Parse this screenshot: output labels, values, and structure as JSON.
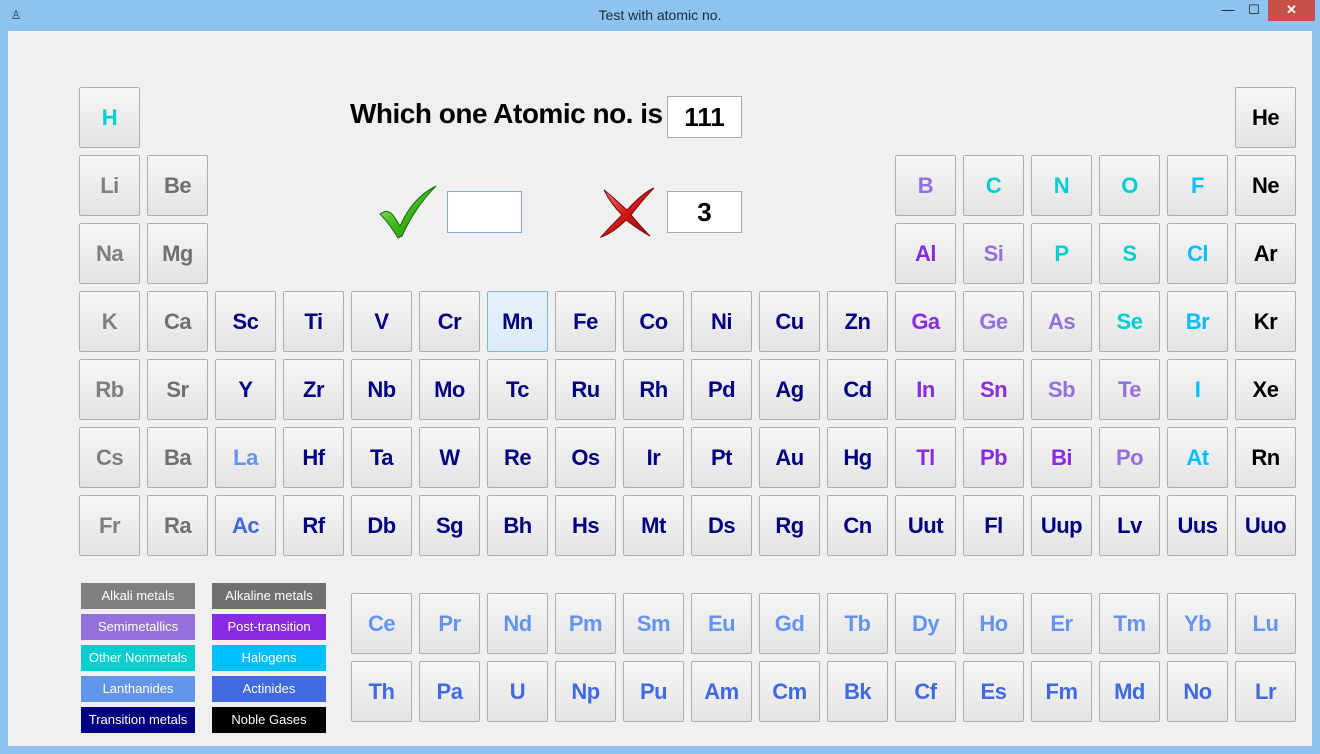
{
  "window": {
    "title": "Test with atomic no.",
    "minimize": "—",
    "maximize": "☐",
    "close": "✕"
  },
  "question": {
    "label": "Which one Atomic no. is :",
    "atomic_number": "111",
    "answer_value": "",
    "wrong_count": "3"
  },
  "colors": {
    "alkali": "#7f7f7f",
    "alkaline": "#707070",
    "semimetal": "#9370db",
    "post": "#8a2be2",
    "nonmetal": "#00ced1",
    "halogen": "#00bfff",
    "lanth": "#6495ed",
    "actin": "#4169e1",
    "trans": "#000080",
    "noble": "#000000",
    "hydrogen": "#00ced1"
  },
  "elements": [
    {
      "symbol": "H",
      "row": 0,
      "col": 0,
      "cat": "hydrogen"
    },
    {
      "symbol": "He",
      "row": 0,
      "col": 17,
      "cat": "noble"
    },
    {
      "symbol": "Li",
      "row": 1,
      "col": 0,
      "cat": "alkali"
    },
    {
      "symbol": "Be",
      "row": 1,
      "col": 1,
      "cat": "alkaline"
    },
    {
      "symbol": "B",
      "row": 1,
      "col": 12,
      "cat": "semimetal"
    },
    {
      "symbol": "C",
      "row": 1,
      "col": 13,
      "cat": "nonmetal"
    },
    {
      "symbol": "N",
      "row": 1,
      "col": 14,
      "cat": "nonmetal"
    },
    {
      "symbol": "O",
      "row": 1,
      "col": 15,
      "cat": "nonmetal"
    },
    {
      "symbol": "F",
      "row": 1,
      "col": 16,
      "cat": "halogen"
    },
    {
      "symbol": "Ne",
      "row": 1,
      "col": 17,
      "cat": "noble"
    },
    {
      "symbol": "Na",
      "row": 2,
      "col": 0,
      "cat": "alkali"
    },
    {
      "symbol": "Mg",
      "row": 2,
      "col": 1,
      "cat": "alkaline"
    },
    {
      "symbol": "Al",
      "row": 2,
      "col": 12,
      "cat": "post"
    },
    {
      "symbol": "Si",
      "row": 2,
      "col": 13,
      "cat": "semimetal"
    },
    {
      "symbol": "P",
      "row": 2,
      "col": 14,
      "cat": "nonmetal"
    },
    {
      "symbol": "S",
      "row": 2,
      "col": 15,
      "cat": "nonmetal"
    },
    {
      "symbol": "Cl",
      "row": 2,
      "col": 16,
      "cat": "halogen"
    },
    {
      "symbol": "Ar",
      "row": 2,
      "col": 17,
      "cat": "noble"
    },
    {
      "symbol": "K",
      "row": 3,
      "col": 0,
      "cat": "alkali"
    },
    {
      "symbol": "Ca",
      "row": 3,
      "col": 1,
      "cat": "alkaline"
    },
    {
      "symbol": "Sc",
      "row": 3,
      "col": 2,
      "cat": "trans"
    },
    {
      "symbol": "Ti",
      "row": 3,
      "col": 3,
      "cat": "trans"
    },
    {
      "symbol": "V",
      "row": 3,
      "col": 4,
      "cat": "trans"
    },
    {
      "symbol": "Cr",
      "row": 3,
      "col": 5,
      "cat": "trans"
    },
    {
      "symbol": "Mn",
      "row": 3,
      "col": 6,
      "cat": "trans",
      "selected": true
    },
    {
      "symbol": "Fe",
      "row": 3,
      "col": 7,
      "cat": "trans"
    },
    {
      "symbol": "Co",
      "row": 3,
      "col": 8,
      "cat": "trans"
    },
    {
      "symbol": "Ni",
      "row": 3,
      "col": 9,
      "cat": "trans"
    },
    {
      "symbol": "Cu",
      "row": 3,
      "col": 10,
      "cat": "trans"
    },
    {
      "symbol": "Zn",
      "row": 3,
      "col": 11,
      "cat": "trans"
    },
    {
      "symbol": "Ga",
      "row": 3,
      "col": 12,
      "cat": "post"
    },
    {
      "symbol": "Ge",
      "row": 3,
      "col": 13,
      "cat": "semimetal"
    },
    {
      "symbol": "As",
      "row": 3,
      "col": 14,
      "cat": "semimetal"
    },
    {
      "symbol": "Se",
      "row": 3,
      "col": 15,
      "cat": "nonmetal"
    },
    {
      "symbol": "Br",
      "row": 3,
      "col": 16,
      "cat": "halogen"
    },
    {
      "symbol": "Kr",
      "row": 3,
      "col": 17,
      "cat": "noble"
    },
    {
      "symbol": "Rb",
      "row": 4,
      "col": 0,
      "cat": "alkali"
    },
    {
      "symbol": "Sr",
      "row": 4,
      "col": 1,
      "cat": "alkaline"
    },
    {
      "symbol": "Y",
      "row": 4,
      "col": 2,
      "cat": "trans"
    },
    {
      "symbol": "Zr",
      "row": 4,
      "col": 3,
      "cat": "trans"
    },
    {
      "symbol": "Nb",
      "row": 4,
      "col": 4,
      "cat": "trans"
    },
    {
      "symbol": "Mo",
      "row": 4,
      "col": 5,
      "cat": "trans"
    },
    {
      "symbol": "Tc",
      "row": 4,
      "col": 6,
      "cat": "trans"
    },
    {
      "symbol": "Ru",
      "row": 4,
      "col": 7,
      "cat": "trans"
    },
    {
      "symbol": "Rh",
      "row": 4,
      "col": 8,
      "cat": "trans"
    },
    {
      "symbol": "Pd",
      "row": 4,
      "col": 9,
      "cat": "trans"
    },
    {
      "symbol": "Ag",
      "row": 4,
      "col": 10,
      "cat": "trans"
    },
    {
      "symbol": "Cd",
      "row": 4,
      "col": 11,
      "cat": "trans"
    },
    {
      "symbol": "In",
      "row": 4,
      "col": 12,
      "cat": "post"
    },
    {
      "symbol": "Sn",
      "row": 4,
      "col": 13,
      "cat": "post"
    },
    {
      "symbol": "Sb",
      "row": 4,
      "col": 14,
      "cat": "semimetal"
    },
    {
      "symbol": "Te",
      "row": 4,
      "col": 15,
      "cat": "semimetal"
    },
    {
      "symbol": "I",
      "row": 4,
      "col": 16,
      "cat": "halogen"
    },
    {
      "symbol": "Xe",
      "row": 4,
      "col": 17,
      "cat": "noble"
    },
    {
      "symbol": "Cs",
      "row": 5,
      "col": 0,
      "cat": "alkali"
    },
    {
      "symbol": "Ba",
      "row": 5,
      "col": 1,
      "cat": "alkaline"
    },
    {
      "symbol": "La",
      "row": 5,
      "col": 2,
      "cat": "lanth"
    },
    {
      "symbol": "Hf",
      "row": 5,
      "col": 3,
      "cat": "trans"
    },
    {
      "symbol": "Ta",
      "row": 5,
      "col": 4,
      "cat": "trans"
    },
    {
      "symbol": "W",
      "row": 5,
      "col": 5,
      "cat": "trans"
    },
    {
      "symbol": "Re",
      "row": 5,
      "col": 6,
      "cat": "trans"
    },
    {
      "symbol": "Os",
      "row": 5,
      "col": 7,
      "cat": "trans"
    },
    {
      "symbol": "Ir",
      "row": 5,
      "col": 8,
      "cat": "trans"
    },
    {
      "symbol": "Pt",
      "row": 5,
      "col": 9,
      "cat": "trans"
    },
    {
      "symbol": "Au",
      "row": 5,
      "col": 10,
      "cat": "trans"
    },
    {
      "symbol": "Hg",
      "row": 5,
      "col": 11,
      "cat": "trans"
    },
    {
      "symbol": "Tl",
      "row": 5,
      "col": 12,
      "cat": "post"
    },
    {
      "symbol": "Pb",
      "row": 5,
      "col": 13,
      "cat": "post"
    },
    {
      "symbol": "Bi",
      "row": 5,
      "col": 14,
      "cat": "post"
    },
    {
      "symbol": "Po",
      "row": 5,
      "col": 15,
      "cat": "semimetal"
    },
    {
      "symbol": "At",
      "row": 5,
      "col": 16,
      "cat": "halogen"
    },
    {
      "symbol": "Rn",
      "row": 5,
      "col": 17,
      "cat": "noble"
    },
    {
      "symbol": "Fr",
      "row": 6,
      "col": 0,
      "cat": "alkali"
    },
    {
      "symbol": "Ra",
      "row": 6,
      "col": 1,
      "cat": "alkaline"
    },
    {
      "symbol": "Ac",
      "row": 6,
      "col": 2,
      "cat": "actin"
    },
    {
      "symbol": "Rf",
      "row": 6,
      "col": 3,
      "cat": "trans"
    },
    {
      "symbol": "Db",
      "row": 6,
      "col": 4,
      "cat": "trans"
    },
    {
      "symbol": "Sg",
      "row": 6,
      "col": 5,
      "cat": "trans"
    },
    {
      "symbol": "Bh",
      "row": 6,
      "col": 6,
      "cat": "trans"
    },
    {
      "symbol": "Hs",
      "row": 6,
      "col": 7,
      "cat": "trans"
    },
    {
      "symbol": "Mt",
      "row": 6,
      "col": 8,
      "cat": "trans"
    },
    {
      "symbol": "Ds",
      "row": 6,
      "col": 9,
      "cat": "trans"
    },
    {
      "symbol": "Rg",
      "row": 6,
      "col": 10,
      "cat": "trans"
    },
    {
      "symbol": "Cn",
      "row": 6,
      "col": 11,
      "cat": "trans"
    },
    {
      "symbol": "Uut",
      "row": 6,
      "col": 12,
      "cat": "trans"
    },
    {
      "symbol": "Fl",
      "row": 6,
      "col": 13,
      "cat": "trans"
    },
    {
      "symbol": "Uup",
      "row": 6,
      "col": 14,
      "cat": "trans"
    },
    {
      "symbol": "Lv",
      "row": 6,
      "col": 15,
      "cat": "trans"
    },
    {
      "symbol": "Uus",
      "row": 6,
      "col": 16,
      "cat": "trans"
    },
    {
      "symbol": "Uuo",
      "row": 6,
      "col": 17,
      "cat": "trans"
    },
    {
      "symbol": "Ce",
      "row": 7,
      "col": 4,
      "cat": "lanth"
    },
    {
      "symbol": "Pr",
      "row": 7,
      "col": 5,
      "cat": "lanth"
    },
    {
      "symbol": "Nd",
      "row": 7,
      "col": 6,
      "cat": "lanth"
    },
    {
      "symbol": "Pm",
      "row": 7,
      "col": 7,
      "cat": "lanth"
    },
    {
      "symbol": "Sm",
      "row": 7,
      "col": 8,
      "cat": "lanth"
    },
    {
      "symbol": "Eu",
      "row": 7,
      "col": 9,
      "cat": "lanth"
    },
    {
      "symbol": "Gd",
      "row": 7,
      "col": 10,
      "cat": "lanth"
    },
    {
      "symbol": "Tb",
      "row": 7,
      "col": 11,
      "cat": "lanth"
    },
    {
      "symbol": "Dy",
      "row": 7,
      "col": 12,
      "cat": "lanth"
    },
    {
      "symbol": "Ho",
      "row": 7,
      "col": 13,
      "cat": "lanth"
    },
    {
      "symbol": "Er",
      "row": 7,
      "col": 14,
      "cat": "lanth"
    },
    {
      "symbol": "Tm",
      "row": 7,
      "col": 15,
      "cat": "lanth"
    },
    {
      "symbol": "Yb",
      "row": 7,
      "col": 16,
      "cat": "lanth"
    },
    {
      "symbol": "Lu",
      "row": 7,
      "col": 17,
      "cat": "lanth"
    },
    {
      "symbol": "Th",
      "row": 8,
      "col": 4,
      "cat": "actin"
    },
    {
      "symbol": "Pa",
      "row": 8,
      "col": 5,
      "cat": "actin"
    },
    {
      "symbol": "U",
      "row": 8,
      "col": 6,
      "cat": "actin"
    },
    {
      "symbol": "Np",
      "row": 8,
      "col": 7,
      "cat": "actin"
    },
    {
      "symbol": "Pu",
      "row": 8,
      "col": 8,
      "cat": "actin"
    },
    {
      "symbol": "Am",
      "row": 8,
      "col": 9,
      "cat": "actin"
    },
    {
      "symbol": "Cm",
      "row": 8,
      "col": 10,
      "cat": "actin"
    },
    {
      "symbol": "Bk",
      "row": 8,
      "col": 11,
      "cat": "actin"
    },
    {
      "symbol": "Cf",
      "row": 8,
      "col": 12,
      "cat": "actin"
    },
    {
      "symbol": "Es",
      "row": 8,
      "col": 13,
      "cat": "actin"
    },
    {
      "symbol": "Fm",
      "row": 8,
      "col": 14,
      "cat": "actin"
    },
    {
      "symbol": "Md",
      "row": 8,
      "col": 15,
      "cat": "actin"
    },
    {
      "symbol": "No",
      "row": 8,
      "col": 16,
      "cat": "actin"
    },
    {
      "symbol": "Lr",
      "row": 8,
      "col": 17,
      "cat": "actin"
    }
  ],
  "legend": [
    {
      "label": "Alkali metals",
      "cat": "alkali"
    },
    {
      "label": "Alkaline metals",
      "cat": "alkaline"
    },
    {
      "label": "Semimetallics",
      "cat": "semimetal"
    },
    {
      "label": "Post-transition",
      "cat": "post"
    },
    {
      "label": "Other Nonmetals",
      "cat": "nonmetal"
    },
    {
      "label": "Halogens",
      "cat": "halogen"
    },
    {
      "label": "Lanthanides",
      "cat": "lanth"
    },
    {
      "label": "Actinides",
      "cat": "actin"
    },
    {
      "label": "Transition metals",
      "cat": "trans"
    },
    {
      "label": "Noble Gases",
      "cat": "noble"
    }
  ]
}
